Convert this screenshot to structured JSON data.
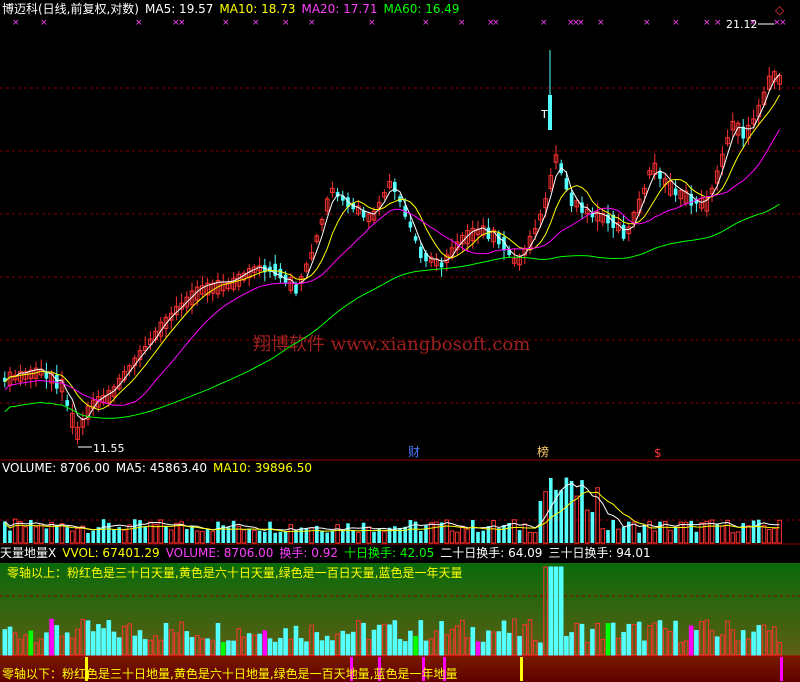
{
  "colors": {
    "background": "#000000",
    "up": "#ff3232",
    "down": "#54ffff",
    "ma5": "#ffffff",
    "ma10": "#ffff00",
    "ma20": "#ff00ff",
    "ma60": "#00ff00",
    "grid": "#800000",
    "text_white": "#ffffff",
    "text_yellow": "#ffff00",
    "text_magenta": "#ff40ff",
    "text_green": "#00ff00"
  },
  "main_panel": {
    "title": "博迈科(日线,前复权,对数)",
    "ma5": "MA5: 19.57",
    "ma10": "MA10: 18.73",
    "ma20": "MA20: 17.71",
    "ma60": "MA60: 16.49",
    "high_label": "21.12",
    "low_label": "11.55",
    "watermark": "翔博软件 www.xiangbosoft.com",
    "event_cai": "财",
    "event_bang": "榜",
    "event_dollar": "$",
    "t_mark": "T",
    "diamond_icon": "◇",
    "markers_text": "× × × × × × × × ×"
  },
  "volume_panel": {
    "volume": "VOLUME: 8706.00",
    "ma5": "MA5: 45863.40",
    "ma10": "MA10: 39896.50"
  },
  "indicator_panel": {
    "name": "天量地量X",
    "vvol": "VVOL: 67401.29",
    "volume": "VOLUME: 8706.00",
    "huanshou": "换手: 0.92",
    "shiri": "十日换手: 42.05",
    "ershiri": "二十日换手: 64.09",
    "sanshiri": "三十日换手: 94.01",
    "note_above": "零轴以上：粉红色是三十日天量,黄色是六十日天量,绿色是一百日天量,蓝色是一年天量",
    "note_below": "零轴以下：粉红色是三十日地量,黄色是六十日地量,绿色是一百天地量,蓝色是一年地量"
  }
}
